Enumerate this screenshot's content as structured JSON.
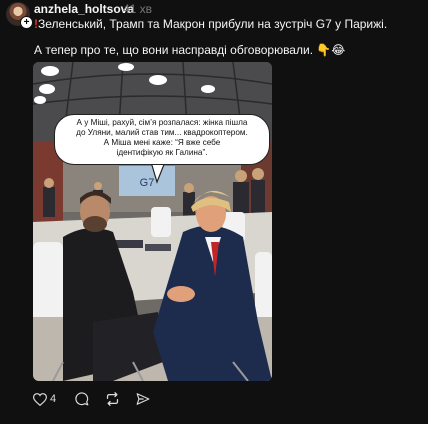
{
  "post": {
    "username": "anzhela_holtsova",
    "timestamp": "41 хв",
    "line1_mark": "!",
    "line1_text": "Зеленський, Трамп та Макрон прибули на зустріч G7 у Парижі.",
    "line2_text": "А тепер про те, що вони насправді обговорювали. 👇😂"
  },
  "image": {
    "sign_text": "G7",
    "bubble_lines": [
      "А у Міші, рахуй, сім’я розпалася: жінка пішла",
      "до Уляни, малий став тим... квадрокоптером.",
      "А Міша мені каже: “Я вже себе",
      "ідентифікую як Галина”."
    ]
  },
  "actions": {
    "like_count": "4",
    "icons": [
      "heart-icon",
      "comment-icon",
      "repost-icon",
      "share-icon"
    ]
  },
  "colors": {
    "background": "#101010",
    "text": "#f3f5f7",
    "muted": "#777777",
    "accent_red": "#e0322f"
  }
}
